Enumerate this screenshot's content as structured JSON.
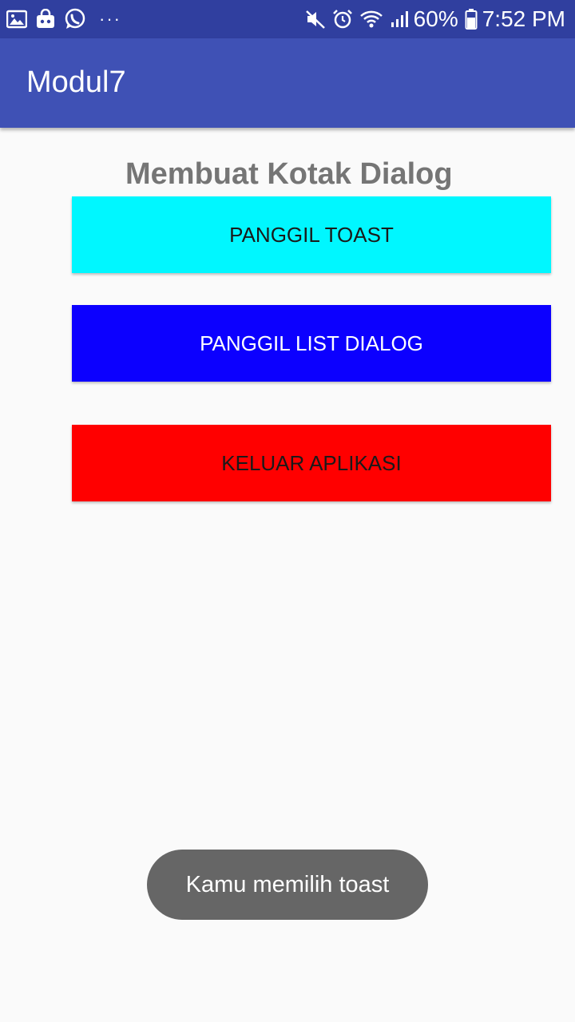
{
  "status_bar": {
    "battery_percent": "60%",
    "time": "7:52 PM",
    "left_icons": [
      "gallery-icon",
      "shopping-bag-icon",
      "whatsapp-icon",
      "more-notifications-icon"
    ],
    "right_icons": [
      "mute-icon",
      "alarm-icon",
      "wifi-icon",
      "signal-icon",
      "battery-icon"
    ]
  },
  "app_bar": {
    "title": "Modul7"
  },
  "main": {
    "heading": "Membuat Kotak Dialog",
    "buttons": [
      {
        "label": "PANGGIL TOAST",
        "color": "#00f7ff"
      },
      {
        "label": "PANGGIL LIST DIALOG",
        "color": "#0c00ff"
      },
      {
        "label": "KELUAR APLIKASI",
        "color": "#ff0000"
      }
    ]
  },
  "toast": {
    "message": "Kamu memilih toast"
  },
  "colors": {
    "status_bar": "#303f9f",
    "app_bar": "#3f51b5",
    "background": "#fafafa",
    "heading": "#757575"
  }
}
